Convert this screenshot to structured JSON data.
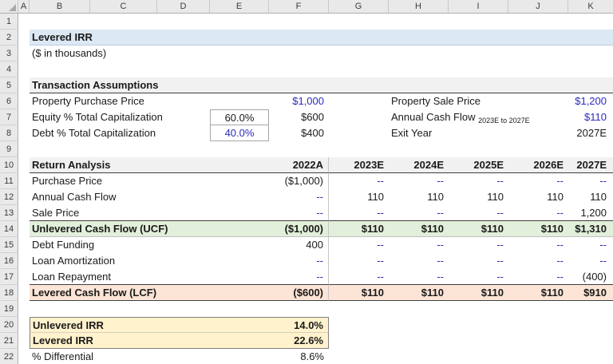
{
  "colors": {
    "title-fill": "#dce8f3",
    "section-fill": "#f1f1f1",
    "ucf-fill": "#e2efda",
    "lcf-fill": "#fce4d6",
    "irr-fill": "#fff2cc",
    "link-blue": "#2b2bbe",
    "header-fill": "#e9e9e9",
    "border-dark": "#3f3f3f",
    "box-border": "#808080"
  },
  "grid": {
    "columns": [
      "A",
      "B",
      "C",
      "D",
      "E",
      "F",
      "G",
      "H",
      "I",
      "J",
      "K"
    ],
    "rows": [
      "1",
      "2",
      "3",
      "4",
      "5",
      "6",
      "7",
      "8",
      "9",
      "10",
      "11",
      "12",
      "13",
      "14",
      "15",
      "16",
      "17",
      "18",
      "19",
      "20",
      "21",
      "22"
    ]
  },
  "doc": {
    "title": "Levered IRR",
    "units": "($ in thousands)"
  },
  "assumptions": {
    "header": "Transaction Assumptions",
    "left": [
      {
        "label": "Property Purchase Price",
        "value": "$1,000"
      },
      {
        "label": "Equity % Total Capitalization",
        "input": "60.0%",
        "value": "$600"
      },
      {
        "label": "Debt % Total Capitalization",
        "input": "40.0%",
        "value": "$400"
      }
    ],
    "right": [
      {
        "label": "Property Sale Price",
        "value": "$1,200"
      },
      {
        "label": "Annual Cash Flow",
        "subscript": "2023E to 2027E",
        "value": "$110"
      },
      {
        "label": "Exit Year",
        "value": "2027E"
      }
    ]
  },
  "ra": {
    "header": "Return Analysis",
    "years": [
      "2022A",
      "2023E",
      "2024E",
      "2025E",
      "2026E",
      "2027E"
    ],
    "rows": [
      {
        "label": "Purchase Price",
        "values": [
          "($1,000)",
          "--",
          "--",
          "--",
          "--",
          "--"
        ]
      },
      {
        "label": "Annual Cash Flow",
        "values": [
          "--",
          "110",
          "110",
          "110",
          "110",
          "110"
        ]
      },
      {
        "label": "Sale Price",
        "values": [
          "--",
          "--",
          "--",
          "--",
          "--",
          "1,200"
        ]
      },
      {
        "label": "Unlevered Cash Flow (UCF)",
        "values": [
          "($1,000)",
          "$110",
          "$110",
          "$110",
          "$110",
          "$1,310"
        ]
      },
      {
        "label": "Debt Funding",
        "values": [
          "400",
          "--",
          "--",
          "--",
          "--",
          "--"
        ]
      },
      {
        "label": "Loan Amortization",
        "values": [
          "--",
          "--",
          "--",
          "--",
          "--",
          "--"
        ]
      },
      {
        "label": "Loan Repayment",
        "values": [
          "--",
          "--",
          "--",
          "--",
          "--",
          "(400)"
        ]
      },
      {
        "label": "Levered Cash Flow (LCF)",
        "values": [
          "($600)",
          "$110",
          "$110",
          "$110",
          "$110",
          "$910"
        ]
      }
    ]
  },
  "irr": {
    "rows": [
      {
        "label": "Unlevered IRR",
        "value": "14.0%"
      },
      {
        "label": "Levered IRR",
        "value": "22.6%"
      },
      {
        "label": "% Differential",
        "value": "8.6%"
      }
    ]
  }
}
